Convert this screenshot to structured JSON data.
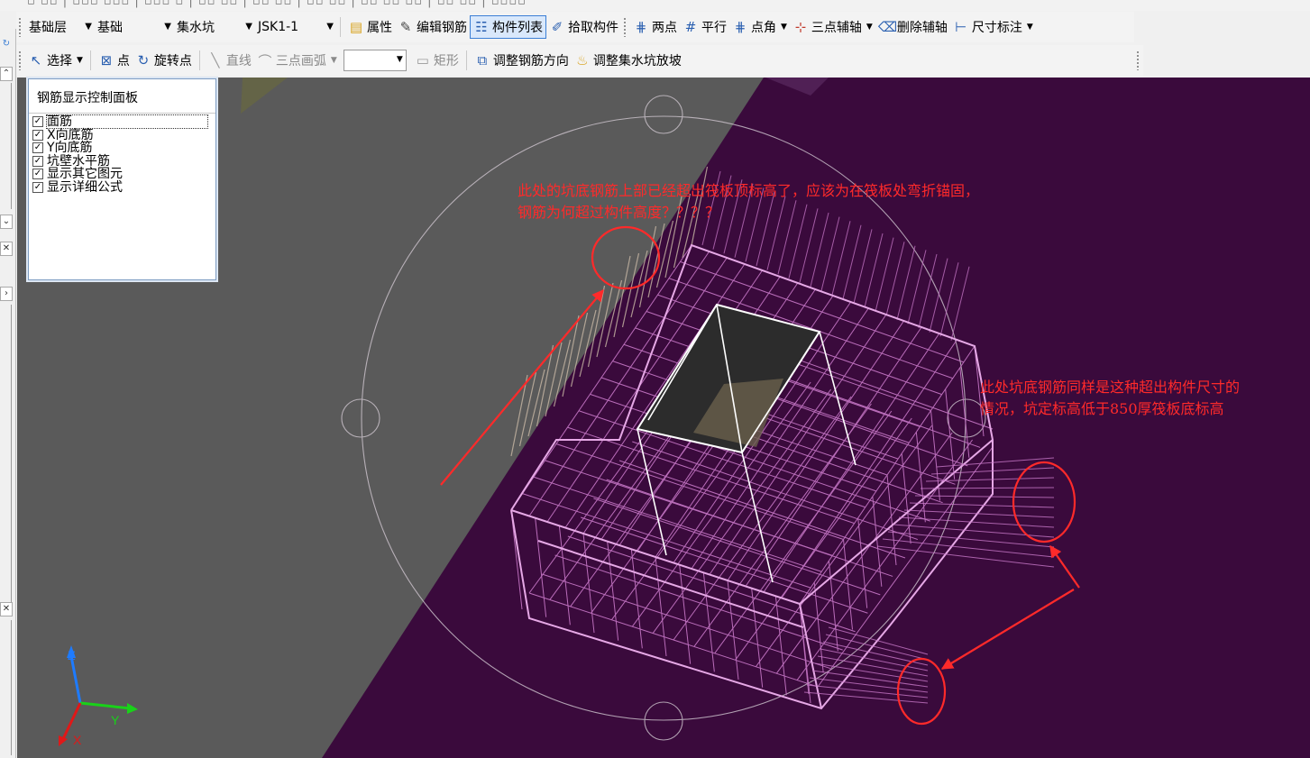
{
  "toolbar_row1": {
    "floor_select": "基础层",
    "category_select": "基础",
    "component_type_select": "集水坑",
    "component_name_select": "JSK1-1",
    "buttons": {
      "properties": "属性",
      "edit_rebar": "编辑钢筋",
      "component_list": "构件列表",
      "pick_component": "拾取构件",
      "two_points": "两点",
      "parallel": "平行",
      "point_angle": "点角",
      "three_point_axis": "三点辅轴",
      "delete_axis": "删除辅轴",
      "dimension": "尺寸标注"
    }
  },
  "toolbar_row2": {
    "buttons": {
      "select": "选择",
      "point": "点",
      "rotate_point": "旋转点",
      "line": "直线",
      "three_point_arc": "三点画弧",
      "rectangle": "矩形",
      "adjust_rebar_direction": "调整钢筋方向",
      "adjust_pit_slope": "调整集水坑放坡"
    },
    "arc_combo_value": ""
  },
  "rebar_panel": {
    "title": "钢筋显示控制面板",
    "items": [
      {
        "label": "面筋",
        "checked": true
      },
      {
        "label": "X向底筋",
        "checked": true
      },
      {
        "label": "Y向底筋",
        "checked": true
      },
      {
        "label": "坑壁水平筋",
        "checked": true
      },
      {
        "label": "显示其它图元",
        "checked": true
      },
      {
        "label": "显示详细公式",
        "checked": true
      }
    ]
  },
  "annotations": {
    "top_line1": "此处的坑底钢筋上部已经超出筏板顶标高了，应该为在筏板处弯折锚固，",
    "top_line2": "钢筋为何超过构件高度？？？？",
    "right_line1": "此处坑底钢筋同样是这种超出构件尺寸的",
    "right_line2": "情况，坑定标高低于850厚筏板底标高"
  },
  "axes": {
    "x": "X",
    "y": "Y",
    "z": "Z"
  },
  "colors": {
    "viewport_bg": "#3a0a3c",
    "raft_gray": "#5a5a5a",
    "rebar": "#c878c8",
    "annotation": "#ff2a2a",
    "accent": "#3c7fd5"
  }
}
